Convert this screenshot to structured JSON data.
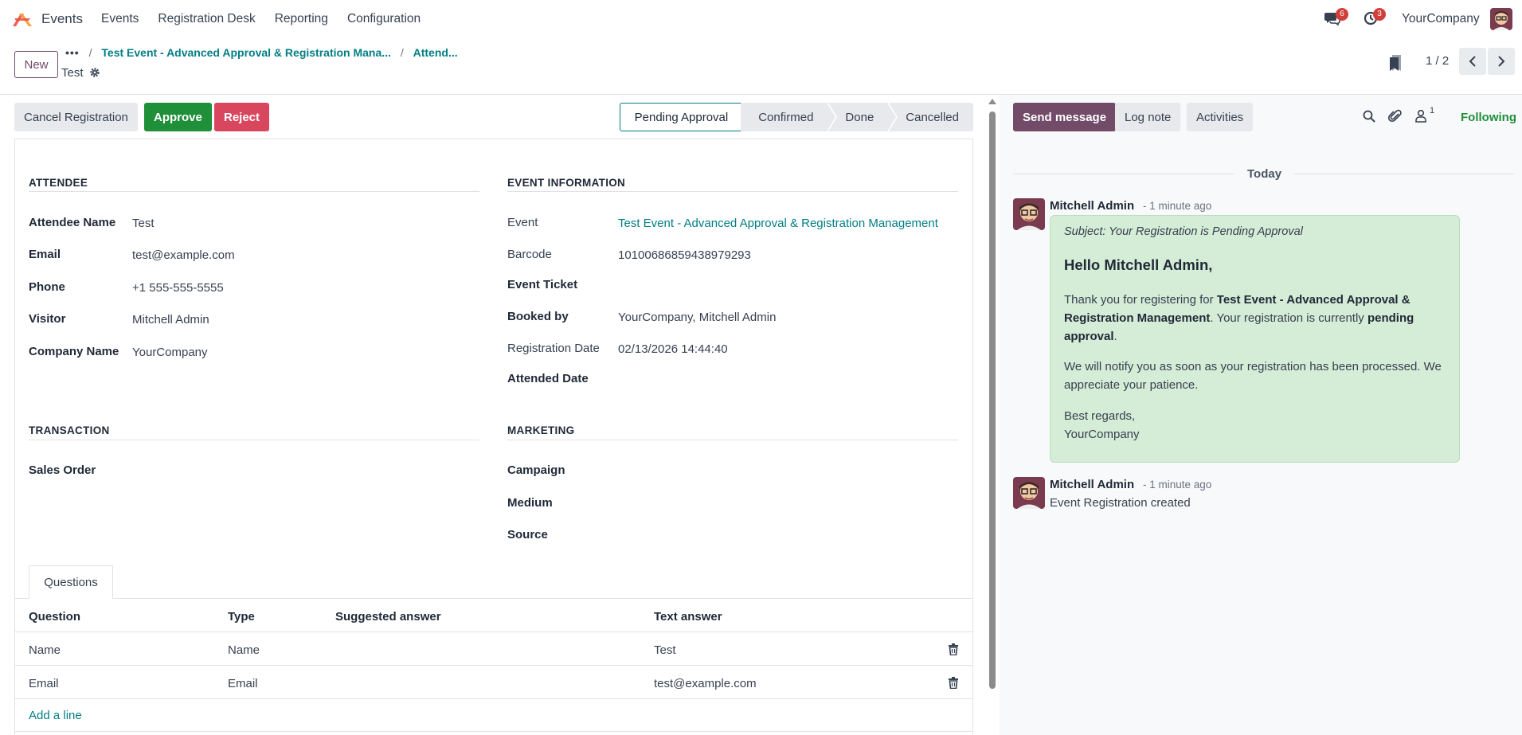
{
  "topbar": {
    "app_name": "Events",
    "menu": [
      "Events",
      "Registration Desk",
      "Reporting",
      "Configuration"
    ],
    "messages_badge": "6",
    "activities_badge": "3",
    "company": "YourCompany"
  },
  "control_panel": {
    "new_label": "New",
    "breadcrumb_more": "•••",
    "breadcrumb_event": "Test Event - Advanced Approval & Registration Mana...",
    "breadcrumb_attendees": "Attend...",
    "record_name": "Test",
    "pager": "1 / 2"
  },
  "status_actions": {
    "cancel_label": "Cancel Registration",
    "approve_label": "Approve",
    "reject_label": "Reject",
    "stages": [
      "Pending Approval",
      "Confirmed",
      "Done",
      "Cancelled"
    ],
    "active_stage": "Pending Approval"
  },
  "attendee": {
    "title": "ATTENDEE",
    "name_label": "Attendee Name",
    "name": "Test",
    "email_label": "Email",
    "email": "test@example.com",
    "phone_label": "Phone",
    "phone": "+1 555-555-5555",
    "visitor_label": "Visitor",
    "visitor": "Mitchell Admin",
    "company_label": "Company Name",
    "company": "YourCompany"
  },
  "event_info": {
    "title": "EVENT INFORMATION",
    "event_label": "Event",
    "event": "Test Event - Advanced Approval & Registration Management",
    "barcode_label": "Barcode",
    "barcode": "10100686859438979293",
    "ticket_label": "Event Ticket",
    "booked_by_label": "Booked by",
    "booked_by": "YourCompany, Mitchell Admin",
    "reg_date_label": "Registration Date",
    "reg_date": "02/13/2026 14:44:40",
    "attended_label": "Attended Date"
  },
  "transaction": {
    "title": "TRANSACTION",
    "sales_order_label": "Sales Order"
  },
  "marketing": {
    "title": "MARKETING",
    "campaign_label": "Campaign",
    "medium_label": "Medium",
    "source_label": "Source"
  },
  "questions": {
    "tab_label": "Questions",
    "headers": [
      "Question",
      "Type",
      "Suggested answer",
      "Text answer"
    ],
    "rows": [
      {
        "question": "Name",
        "type": "Name",
        "suggested": "",
        "text": "Test"
      },
      {
        "question": "Email",
        "type": "Email",
        "suggested": "",
        "text": "test@example.com"
      }
    ],
    "add_line": "Add a line"
  },
  "chatter": {
    "send_message": "Send message",
    "log_note": "Log note",
    "activities": "Activities",
    "followers_count": "1",
    "following": "Following",
    "today": "Today",
    "messages": [
      {
        "author": "Mitchell Admin",
        "when": "- 1 minute ago",
        "subject": "Subject: Your Registration is Pending Approval",
        "hello": "Hello Mitchell Admin,",
        "p1_a": "Thank you for registering for ",
        "p1_b": "Test Event - Advanced Approval & Registration Management",
        "p1_c": ". Your registration is currently ",
        "p1_d": "pending approval",
        "p1_e": ".",
        "p2": "We will notify you as soon as your registration has been processed. We appreciate your patience.",
        "p3_a": "Best regards,",
        "p3_b": "YourCompany"
      },
      {
        "author": "Mitchell Admin",
        "when": "- 1 minute ago",
        "body": "Event Registration created"
      }
    ]
  },
  "colors": {
    "brand": "#714b67",
    "link": "#017e84",
    "approve": "#1f8f3a",
    "reject": "#d9475e",
    "mail_bg": "#d5ecd6"
  }
}
